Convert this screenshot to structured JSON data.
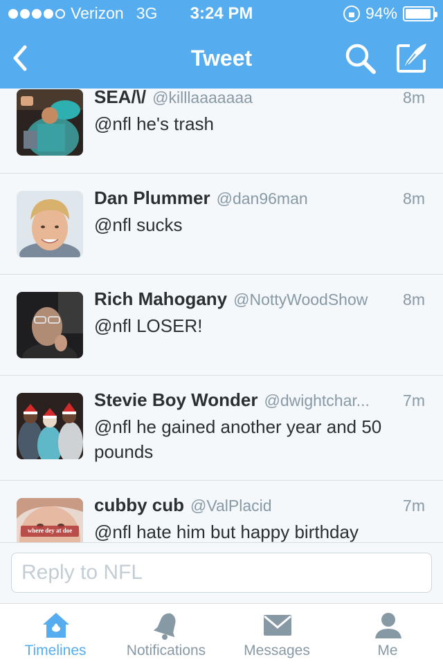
{
  "status_bar": {
    "carrier": "Verizon",
    "network": "3G",
    "time": "3:24 PM",
    "battery": "94%",
    "battery_level": 0.94
  },
  "nav": {
    "title": "Tweet",
    "back_icon": "chevron-left-icon",
    "search_icon": "search-icon",
    "compose_icon": "compose-icon"
  },
  "tweets": [
    {
      "name": "SEA/\\/",
      "handle": "@killlaaaaaaa",
      "time": "8m",
      "text": "@nfl he's trash"
    },
    {
      "name": "Dan Plummer",
      "handle": "@dan96man",
      "time": "8m",
      "text": "@nfl sucks"
    },
    {
      "name": "Rich Mahogany",
      "handle": "@NottyWoodShow",
      "time": "8m",
      "text": "@nfl LOSER!"
    },
    {
      "name": "Stevie Boy Wonder",
      "handle": "@dwightchar...",
      "time": "7m",
      "text": "@nfl he gained another year and 50 pounds"
    },
    {
      "name": "cubby cub",
      "handle": "@ValPlacid",
      "time": "7m",
      "text": "@nfl hate him but happy birthday",
      "avatar_caption": "where dey at doe"
    }
  ],
  "reply": {
    "placeholder": "Reply to NFL",
    "value": ""
  },
  "tabs": [
    {
      "label": "Timelines",
      "icon": "home-icon",
      "active": true
    },
    {
      "label": "Notifications",
      "icon": "bell-icon",
      "active": false
    },
    {
      "label": "Messages",
      "icon": "envelope-icon",
      "active": false
    },
    {
      "label": "Me",
      "icon": "person-icon",
      "active": false
    }
  ],
  "colors": {
    "brand": "#55acee",
    "text": "#292f33",
    "secondary": "#8899a6",
    "background": "#f5f8fa"
  }
}
